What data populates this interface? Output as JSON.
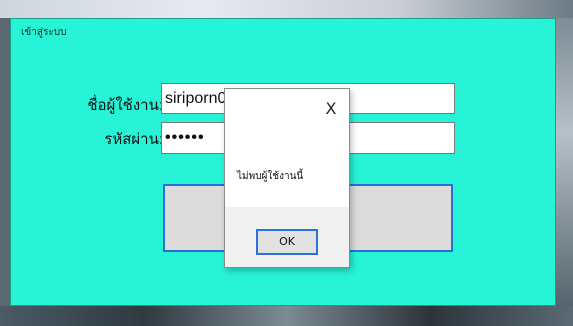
{
  "window": {
    "title": "เข้าสู่ระบบ"
  },
  "login_form": {
    "username_label": "ชื่อผู้ใช้งาน:",
    "username_value": "siriporn0795",
    "password_label": "รหัสผ่าน:",
    "password_value": "••••••",
    "login_button_label": ""
  },
  "message_box": {
    "close_label": "X",
    "message": "ไม่พบผู้ใช้งานนี้",
    "ok_label": "OK"
  },
  "colors": {
    "form_background": "#27f3d7",
    "button_focus_border": "#2a72d8"
  }
}
